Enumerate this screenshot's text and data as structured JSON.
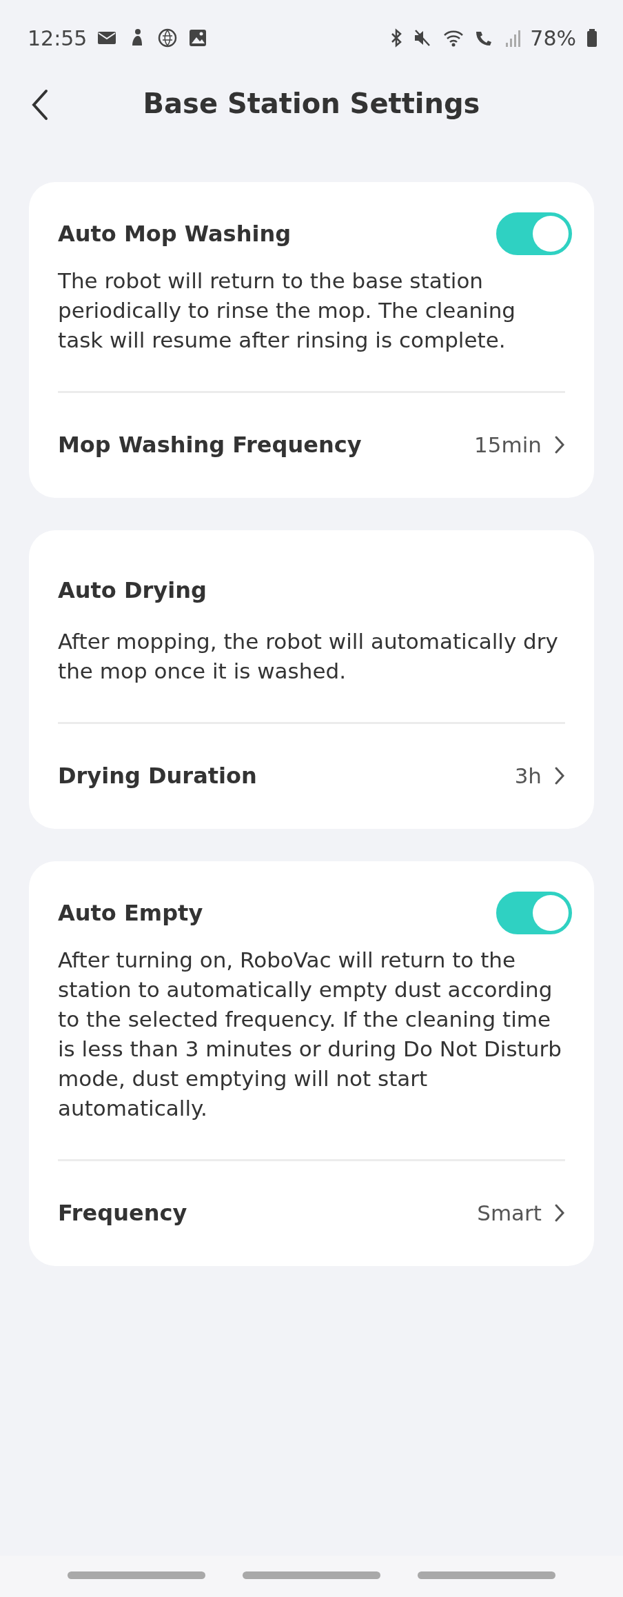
{
  "status_bar": {
    "time": "12:55",
    "battery": "78%"
  },
  "header": {
    "title": "Base Station Settings"
  },
  "cards": [
    {
      "title": "Auto Mop Washing",
      "switch": {
        "on": true
      },
      "description": "The robot will return to the base station periodically to rinse the mop. The cleaning task will resume after rinsing is complete.",
      "setting": {
        "label": "Mop Washing Frequency",
        "value": "15min"
      }
    },
    {
      "title": "Auto Drying",
      "description": "After mopping, the robot will automatically dry the mop once it is washed.",
      "setting": {
        "label": "Drying Duration",
        "value": "3h"
      }
    },
    {
      "title": "Auto Empty",
      "switch": {
        "on": true
      },
      "description": "After turning on, RoboVac will return to the station to automatically empty dust according to the selected frequency. If the cleaning time is less than 3 minutes or during Do Not Disturb mode, dust emptying will not start automatically.",
      "setting": {
        "label": "Frequency",
        "value": "Smart"
      }
    }
  ]
}
